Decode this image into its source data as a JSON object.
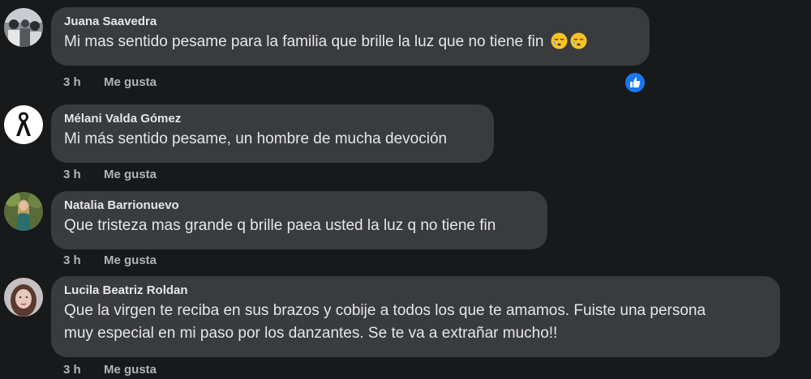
{
  "comments": [
    {
      "author": "Juana Saavedra",
      "text": "Mi mas sentido pesame para la familia que brille la luz que no tiene fin",
      "emoji": [
        "sleepy-face",
        "sleepy-face"
      ],
      "time": "3 h",
      "like_label": "Me gusta",
      "reaction": "like-reaction-icon"
    },
    {
      "author": "Mélani Valda Gómez",
      "text": "Mi más sentido pesame, un hombre de mucha devoción",
      "time": "3 h",
      "like_label": "Me gusta"
    },
    {
      "author": "Natalia Barrionuevo",
      "text": "Que tristeza mas grande q brille paea usted la luz q no tiene fin",
      "time": "3 h",
      "like_label": "Me gusta"
    },
    {
      "author": "Lucila Beatriz Roldan",
      "text_line1": "Que la virgen te reciba en sus brazos y cobije a todos los que te amamos. Fuiste una persona",
      "text_line2": "muy especial en mi paso por los danzantes. Se te va a extrañar mucho!!",
      "time": "3 h",
      "like_label": "Me gusta"
    }
  ],
  "colors": {
    "background": "#18191a",
    "bubble": "#3a3b3c",
    "primary_text": "#e4e6eb",
    "secondary_text": "#b0b3b8",
    "like_blue": "#1877f2"
  }
}
